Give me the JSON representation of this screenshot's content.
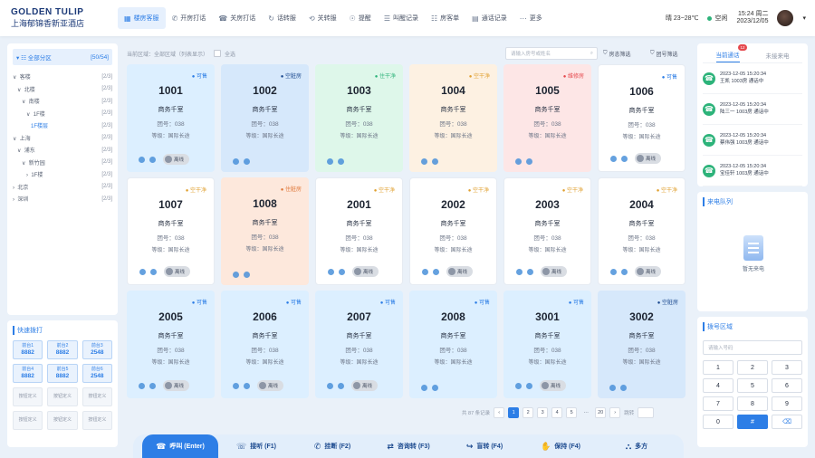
{
  "logo": {
    "line1": "GOLDEN TULIP",
    "line2": "上海郁锦香新亚酒店"
  },
  "nav": [
    {
      "label": "楼房客服",
      "icon": "▦",
      "active": true
    },
    {
      "label": "开房打话",
      "icon": "✆",
      "active": false
    },
    {
      "label": "关房打话",
      "icon": "☎",
      "active": false
    },
    {
      "label": "话转服",
      "icon": "↻",
      "active": false
    },
    {
      "label": "关转服",
      "icon": "⟲",
      "active": false
    },
    {
      "label": "提醒",
      "icon": "☉",
      "active": false
    },
    {
      "label": "叫醒记录",
      "icon": "☰",
      "active": false
    },
    {
      "label": "房客单",
      "icon": "☷",
      "active": false
    },
    {
      "label": "通话记录",
      "icon": "▤",
      "active": false
    },
    {
      "label": "更多",
      "icon": "⋯",
      "active": false
    }
  ],
  "top": {
    "weather": "晴 23~28℃",
    "status": "空闲",
    "time": "15:24 周二",
    "date": "2023/12/05"
  },
  "tree": {
    "root_label": "全部分区",
    "root_count": "[50/54]",
    "items": [
      {
        "label": "∨  客楼",
        "count": "[2/3]",
        "sel": false
      },
      {
        "label": "   ∨  北楼",
        "count": "[2/3]",
        "sel": false
      },
      {
        "label": "      ∨  南楼",
        "count": "[2/3]",
        "sel": false
      },
      {
        "label": "         ∨  1F楼",
        "count": "[2/3]",
        "sel": false
      },
      {
        "label": "            1F楼层",
        "count": "[2/3]",
        "sel": true
      },
      {
        "label": "∨  上海",
        "count": "[2/3]",
        "sel": false
      },
      {
        "label": "   ∨  浦东",
        "count": "[2/3]",
        "sel": false
      },
      {
        "label": "      ∨  新竹园",
        "count": "[2/3]",
        "sel": false
      },
      {
        "label": "         ›  1F楼",
        "count": "[2/3]",
        "sel": false
      },
      {
        "label": "›  北京",
        "count": "[2/3]",
        "sel": false
      },
      {
        "label": "›  深圳",
        "count": "[2/3]",
        "sel": false
      }
    ]
  },
  "quick": {
    "title": "快速拨打",
    "buttons": [
      {
        "label": "前台1",
        "num": "8882",
        "on": true
      },
      {
        "label": "前台2",
        "num": "8882",
        "on": true
      },
      {
        "label": "前台3",
        "num": "2548",
        "on": true
      },
      {
        "label": "前台4",
        "num": "8882",
        "on": true
      },
      {
        "label": "前台5",
        "num": "8882",
        "on": true
      },
      {
        "label": "前台6",
        "num": "2548",
        "on": true
      },
      {
        "label": "按钮定义",
        "num": "",
        "on": false
      },
      {
        "label": "按钮定义",
        "num": "",
        "on": false
      },
      {
        "label": "按钮定义",
        "num": "",
        "on": false
      },
      {
        "label": "按钮定义",
        "num": "",
        "on": false
      },
      {
        "label": "按钮定义",
        "num": "",
        "on": false
      },
      {
        "label": "按钮定义",
        "num": "",
        "on": false
      }
    ]
  },
  "filter": {
    "area": "当前区域：全部区域（列表显示）",
    "select_all": "全选",
    "search_ph": "请输入房号或姓名",
    "f1": "房态筛选",
    "f2": "团号筛选"
  },
  "rooms": [
    {
      "num": "1001",
      "status": "可售",
      "type": "商务千室",
      "group": "团号：038",
      "level": "等级：国际长途",
      "bg": "#dcefff",
      "sc": "#2d7ee6",
      "offline": true
    },
    {
      "num": "1002",
      "status": "空脏房",
      "type": "商务千室",
      "group": "团号：038",
      "level": "等级：国际长途",
      "bg": "#d6e8fb",
      "sc": "#1c4a8f",
      "offline": false
    },
    {
      "num": "1003",
      "status": "住干净",
      "type": "商务千室",
      "group": "团号：038",
      "level": "等级：国际长途",
      "bg": "#def7ea",
      "sc": "#2db37a",
      "offline": false
    },
    {
      "num": "1004",
      "status": "空干净",
      "type": "商务千室",
      "group": "团号：038",
      "level": "等级：国际长途",
      "bg": "#fdf1e2",
      "sc": "#e0a030",
      "offline": false
    },
    {
      "num": "1005",
      "status": "维修房",
      "type": "商务千室",
      "group": "团号：038",
      "level": "等级：国际长途",
      "bg": "#fde6e6",
      "sc": "#e5484d",
      "offline": false
    },
    {
      "num": "1006",
      "status": "可售",
      "type": "商务千室",
      "group": "团号：038",
      "level": "等级：国际长途",
      "bg": "#ffffff",
      "sc": "#2d7ee6",
      "offline": true
    },
    {
      "num": "1007",
      "status": "空干净",
      "type": "商务千室",
      "group": "团号：038",
      "level": "等级：国际长途",
      "bg": "#ffffff",
      "sc": "#e0a030",
      "offline": true
    },
    {
      "num": "1008",
      "status": "住脏房",
      "type": "商务千室",
      "group": "团号：038",
      "level": "等级：国际长途",
      "bg": "#fde8dc",
      "sc": "#e0783a",
      "offline": false
    },
    {
      "num": "2001",
      "status": "空干净",
      "type": "商务千室",
      "group": "团号：038",
      "level": "等级：国际长途",
      "bg": "#ffffff",
      "sc": "#e0a030",
      "offline": true
    },
    {
      "num": "2002",
      "status": "空干净",
      "type": "商务千室",
      "group": "团号：038",
      "level": "等级：国际长途",
      "bg": "#ffffff",
      "sc": "#e0a030",
      "offline": true
    },
    {
      "num": "2003",
      "status": "空干净",
      "type": "商务千室",
      "group": "团号：038",
      "level": "等级：国际长途",
      "bg": "#ffffff",
      "sc": "#e0a030",
      "offline": true
    },
    {
      "num": "2004",
      "status": "空干净",
      "type": "商务千室",
      "group": "团号：038",
      "level": "等级：国际长途",
      "bg": "#ffffff",
      "sc": "#e0a030",
      "offline": true
    },
    {
      "num": "2005",
      "status": "可售",
      "type": "商务千室",
      "group": "团号：038",
      "level": "等级：国际长途",
      "bg": "#dcefff",
      "sc": "#2d7ee6",
      "offline": true
    },
    {
      "num": "2006",
      "status": "可售",
      "type": "商务千室",
      "group": "团号：038",
      "level": "等级：国际长途",
      "bg": "#dcefff",
      "sc": "#2d7ee6",
      "offline": true
    },
    {
      "num": "2007",
      "status": "可售",
      "type": "商务千室",
      "group": "团号：038",
      "level": "等级：国际长途",
      "bg": "#dcefff",
      "sc": "#2d7ee6",
      "offline": true
    },
    {
      "num": "2008",
      "status": "可售",
      "type": "商务千室",
      "group": "团号：038",
      "level": "等级：国际长途",
      "bg": "#dcefff",
      "sc": "#2d7ee6",
      "offline": false
    },
    {
      "num": "3001",
      "status": "可售",
      "type": "商务千室",
      "group": "团号：038",
      "level": "等级：国际长途",
      "bg": "#dcefff",
      "sc": "#2d7ee6",
      "offline": true
    },
    {
      "num": "3002",
      "status": "空脏房",
      "type": "商务千室",
      "group": "团号：038",
      "level": "等级：国际长途",
      "bg": "#d6e8fb",
      "sc": "#1c4a8f",
      "offline": false
    }
  ],
  "offline_label": "离线",
  "pager": {
    "total": "共 87 条记录",
    "pages": [
      "1",
      "2",
      "3",
      "4",
      "5",
      "···",
      "20"
    ],
    "jump": "跳转"
  },
  "calls": {
    "tab_a": "当前通话",
    "badge": "12",
    "tab_b": "未接来电",
    "items": [
      {
        "time": "2023-12-05 15:20:34",
        "text": "王凯 1003房 通话中"
      },
      {
        "time": "2023-12-05 15:20:34",
        "text": "陆三一 1003房 通话中"
      },
      {
        "time": "2023-12-05 15:20:34",
        "text": "蔡伟强 1003房 通话中"
      },
      {
        "time": "2023-12-05 15:20:34",
        "text": "宝佳轩 1003房 通话中"
      }
    ]
  },
  "queue": {
    "title": "来电队列",
    "empty": "暂无来电"
  },
  "dial": {
    "title": "拨号区域",
    "placeholder": "请输入号码",
    "keys": [
      "1",
      "2",
      "3",
      "4",
      "5",
      "6",
      "7",
      "8",
      "9",
      "0",
      "#",
      "⌫"
    ]
  },
  "bottom": [
    {
      "label": "呼叫 (Enter)",
      "icon": "☎",
      "main": true
    },
    {
      "label": "接听 (F1)",
      "icon": "☏",
      "main": false
    },
    {
      "label": "挂断 (F2)",
      "icon": "✆",
      "main": false
    },
    {
      "label": "咨询转 (F3)",
      "icon": "⇄",
      "main": false
    },
    {
      "label": "盲转 (F4)",
      "icon": "↪",
      "main": false
    },
    {
      "label": "保持 (F4)",
      "icon": "✋",
      "main": false
    },
    {
      "label": "多方",
      "icon": "⛬",
      "main": false
    }
  ]
}
